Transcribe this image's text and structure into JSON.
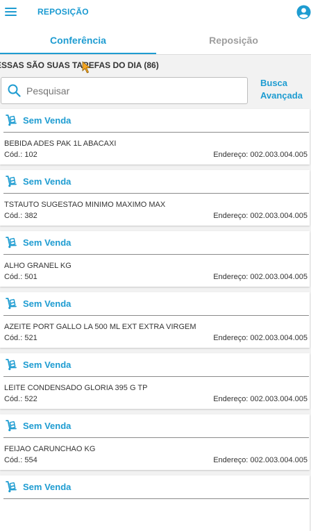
{
  "appbar": {
    "title": "REPOSIÇÃO",
    "menu_icon": "menu-icon",
    "account_icon": "account-icon",
    "accent_color": "#1e9cd1"
  },
  "tabs": [
    {
      "label": "Conferência",
      "active": true
    },
    {
      "label": "Reposição",
      "active": false
    }
  ],
  "tasks_header": "ESSAS SÃO SUAS TAREFAS DO DIA (86)",
  "search": {
    "placeholder": "Pesquisar",
    "value": "",
    "icon": "search-icon"
  },
  "advanced_search": {
    "line1": "Busca",
    "line2": "Avançada"
  },
  "tasks": [
    {
      "status": "Sem Venda",
      "description": "BEBIDA ADES PAK 1L ABACAXI",
      "code": "Cód.: 102",
      "address": "Endereço: 002.003.004.005"
    },
    {
      "status": "Sem Venda",
      "description": "TSTAUTO SUGESTAO MINIMO MAXIMO MAX",
      "code": "Cód.: 382",
      "address": "Endereço: 002.003.004.005"
    },
    {
      "status": "Sem Venda",
      "description": "ALHO GRANEL KG",
      "code": "Cód.: 501",
      "address": "Endereço: 002.003.004.005"
    },
    {
      "status": "Sem Venda",
      "description": "AZEITE PORT GALLO LA 500 ML EXT EXTRA VIRGEM",
      "code": "Cód.: 521",
      "address": "Endereço: 002.003.004.005"
    },
    {
      "status": "Sem Venda",
      "description": "LEITE CONDENSADO GLORIA 395 G TP",
      "code": "Cód.: 522",
      "address": "Endereço: 002.003.004.005"
    },
    {
      "status": "Sem Venda",
      "description": "FEIJAO CARUNCHAO KG",
      "code": "Cód.: 554",
      "address": "Endereço: 002.003.004.005"
    },
    {
      "status": "Sem Venda",
      "description": "",
      "code": "",
      "address": ""
    }
  ],
  "task_icon": "hand-truck-icon"
}
